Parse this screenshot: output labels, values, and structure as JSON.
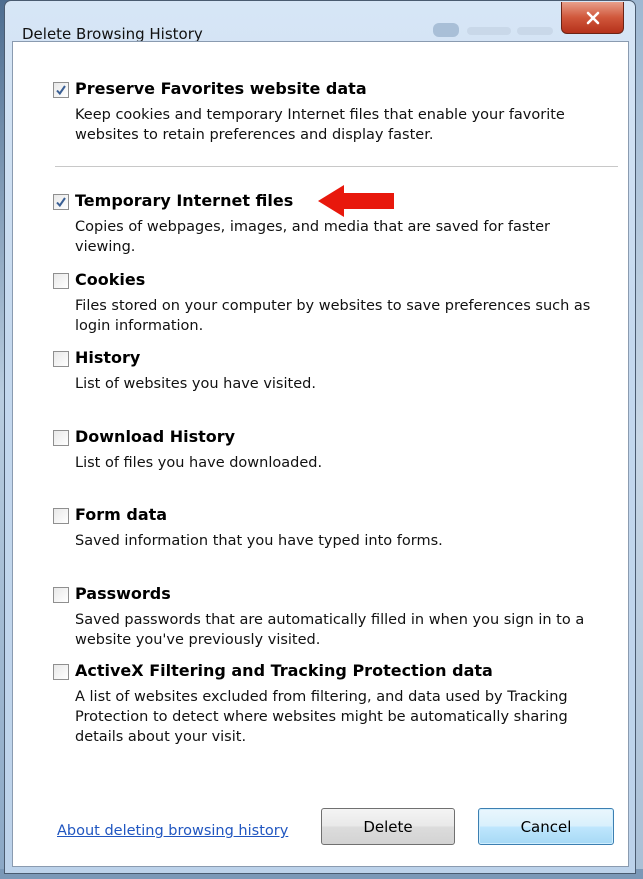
{
  "window": {
    "title": "Delete Browsing History"
  },
  "options": [
    {
      "label": "Preserve Favorites website data",
      "checked": true,
      "description": "Keep cookies and temporary Internet files that enable your favorite websites to retain preferences and display faster."
    },
    {
      "label": "Temporary Internet files",
      "checked": true,
      "description": "Copies of webpages, images, and media that are saved for faster viewing."
    },
    {
      "label": "Cookies",
      "checked": false,
      "description": "Files stored on your computer by websites to save preferences such as login information."
    },
    {
      "label": "History",
      "checked": false,
      "description": "List of websites you have visited."
    },
    {
      "label": "Download History",
      "checked": false,
      "description": "List of files you have downloaded."
    },
    {
      "label": "Form data",
      "checked": false,
      "description": "Saved information that you have typed into forms."
    },
    {
      "label": "Passwords",
      "checked": false,
      "description": "Saved passwords that are automatically filled in when you sign in to a website you've previously visited."
    },
    {
      "label": "ActiveX Filtering and Tracking Protection data",
      "checked": false,
      "description": "A list of websites excluded from filtering, and data used by Tracking Protection to detect where websites might be automatically sharing details about your visit."
    }
  ],
  "footer": {
    "help_link": "About deleting browsing history",
    "delete_label": "Delete",
    "cancel_label": "Cancel"
  },
  "annotation": {
    "arrow_icon": "red-arrow-left-icon",
    "arrow_color": "#e8180c"
  },
  "colors": {
    "close_button": "#c9462b",
    "link": "#2056c0"
  }
}
